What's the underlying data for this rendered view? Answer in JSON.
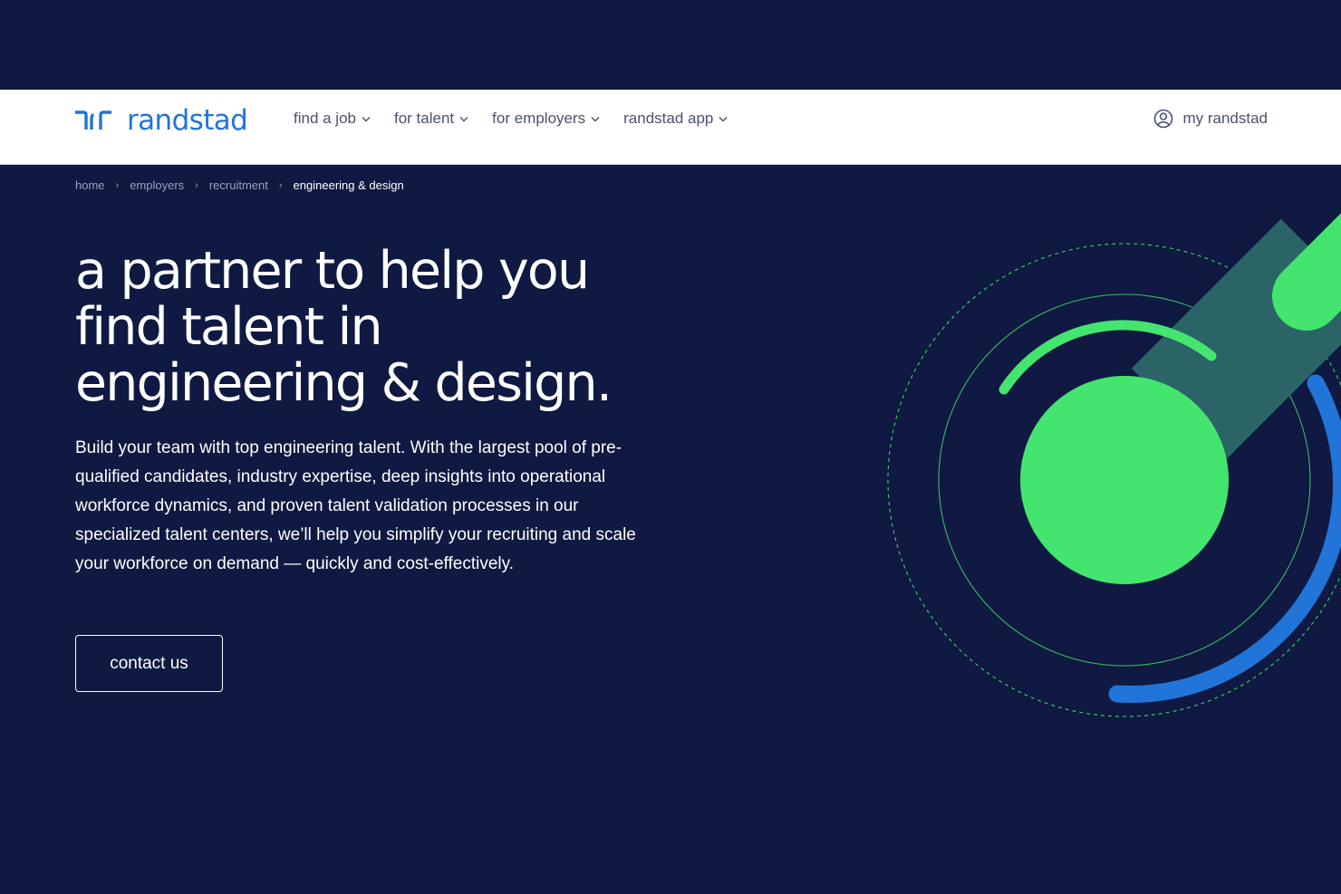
{
  "header": {
    "logo_text": "randstad",
    "nav": [
      {
        "label": "find a job"
      },
      {
        "label": "for talent"
      },
      {
        "label": "for employers"
      },
      {
        "label": "randstad app"
      }
    ],
    "account_label": "my randstad"
  },
  "breadcrumb": [
    "home",
    "employers",
    "recruitment",
    "engineering & design"
  ],
  "hero": {
    "title_lines": [
      "a partner to help you",
      "find talent in",
      "engineering & design."
    ],
    "body": "Build your team with top engineering talent. With the largest pool of pre-qualified candidates, industry expertise, deep insights into operational workforce dynamics, and proven talent validation processes in our specialized talent centers, we’ll help you simplify your recruiting and scale your workforce on demand — quickly and cost-effectively.",
    "cta_label": "contact us"
  },
  "colors": {
    "background": "#0f1941",
    "brand_blue": "#2175d9",
    "accent_green": "#43e56f",
    "teal": "#2a6466"
  },
  "icons": [
    "randstad-logo-icon",
    "chevron-down-icon",
    "user-circle-icon",
    "chevron-right-icon"
  ]
}
